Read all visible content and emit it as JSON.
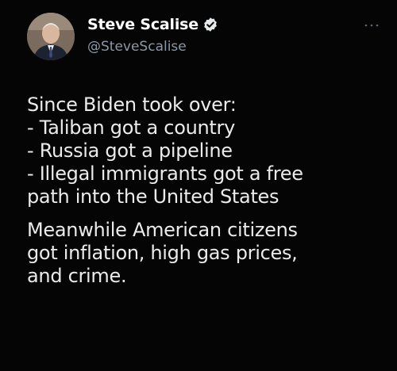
{
  "tweet": {
    "display_name": "Steve Scalise",
    "handle": "@SteveScalise",
    "verified": true,
    "icons": {
      "verified": "verified-badge-icon",
      "more": "more-dots-icon"
    },
    "paragraph1": [
      "Since Biden took over:",
      "- Taliban got a country",
      "- Russia got a pipeline",
      "- Illegal immigrants got a free",
      "path into the United States"
    ],
    "paragraph2": [
      "Meanwhile American citizens",
      "got inflation, high gas prices,",
      "and crime."
    ]
  },
  "colors": {
    "background": "#050505",
    "name": "#ffffff",
    "handle": "#8b98a5",
    "text": "#ebebeb",
    "verified_badge": "#e7e9ea"
  }
}
